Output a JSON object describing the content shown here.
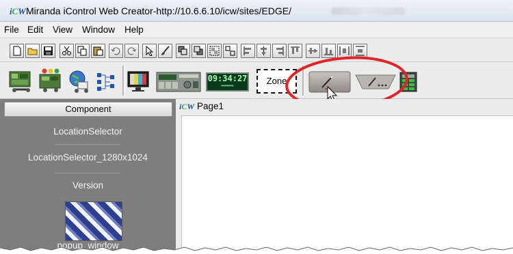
{
  "window": {
    "title": "Miranda iControl Web Creator-http://10.6.6.10/icw/sites/EDGE/",
    "logo": "iCW",
    "logo_icon": "icw-logo-icon"
  },
  "menu": [
    "File",
    "Edit",
    "View",
    "Window",
    "Help"
  ],
  "toolbar1": {
    "icons": [
      "new-file-icon",
      "open-folder-icon",
      "save-icon",
      "cut-icon",
      "copy-icon",
      "paste-icon",
      "undo-icon",
      "redo-icon",
      "select-arrow-icon",
      "brush-icon",
      "bring-front-icon",
      "send-back-icon",
      "group-icon",
      "ungroup-icon",
      "align-left-icon",
      "align-center-icon",
      "align-right-icon",
      "align-top-icon",
      "align-middle-icon",
      "align-bottom-icon",
      "distribute-horizontal-icon",
      "distribute-vertical-icon"
    ]
  },
  "toolbar2": {
    "icons": [
      "device-link-icon",
      "alarm-device-icon",
      "globe-link-icon",
      "tree-grid-icon",
      "monitor-icon",
      "router-panel-icon",
      "clock-widget-icon",
      "zone-widget-icon",
      "button-widget-icon",
      "tab-widget-icon",
      "grid-panel-icon"
    ],
    "clock_time": "09:34:27",
    "zone_label": "Zone",
    "highlighted_tool": "button-widget-icon",
    "highlight_color": "#e0242a"
  },
  "component_panel": {
    "header": "Component",
    "items": [
      "LocationSelector",
      "LocationSelector_1280x1024",
      "Version",
      "popup_window"
    ]
  },
  "page": {
    "tab_label": "Page1"
  },
  "colors": {
    "panel_bg": "#7e7e7e",
    "titlebar_bg": "#dbe4ee",
    "toolbar_bg": "#ececec",
    "accent": "#1a4fa0"
  }
}
